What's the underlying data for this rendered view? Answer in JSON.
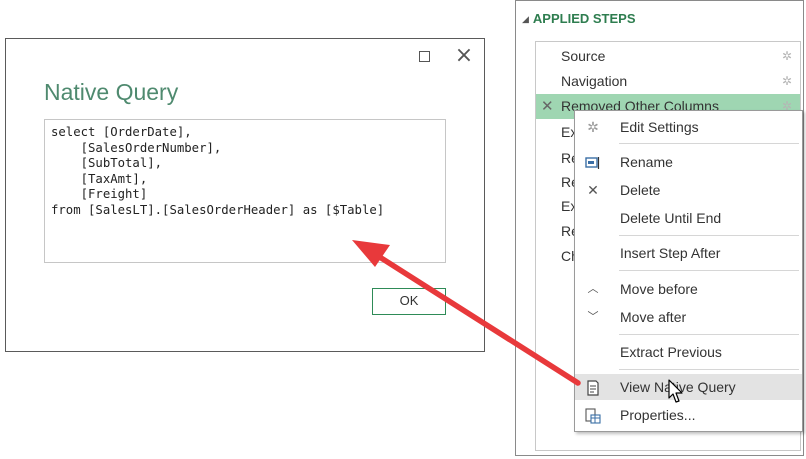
{
  "dialog": {
    "title": "Native Query",
    "query_lines": [
      "select [OrderDate],",
      "    [SalesOrderNumber],",
      "    [SubTotal],",
      "    [TaxAmt],",
      "    [Freight]",
      "from [SalesLT].[SalesOrderHeader] as [$Table]"
    ],
    "maximize_icon": "maximize-icon",
    "close_icon": "close-icon",
    "ok_label": "OK"
  },
  "applied_steps": {
    "header": "APPLIED STEPS",
    "steps": [
      {
        "label": "Source"
      },
      {
        "label": "Navigation"
      },
      {
        "label": "Removed Other Columns"
      }
    ],
    "hidden_fragments": [
      "Ex",
      "Re",
      "Re",
      "Ex",
      "Re",
      "Ch"
    ]
  },
  "context_menu": {
    "items": [
      {
        "label": "Edit Settings",
        "icon": "gear-icon"
      },
      {
        "label": "Rename",
        "icon": "rename-icon"
      },
      {
        "label": "Delete",
        "icon": "delete-icon"
      },
      {
        "label": "Delete Until End",
        "icon": ""
      },
      {
        "label": "Insert Step After",
        "icon": ""
      },
      {
        "label": "Move before",
        "icon": "chevron-up-icon"
      },
      {
        "label": "Move after",
        "icon": "chevron-down-icon"
      },
      {
        "label": "Extract Previous",
        "icon": ""
      },
      {
        "label": "View Native Query",
        "icon": "view-query-icon"
      },
      {
        "label": "Properties...",
        "icon": "properties-icon"
      }
    ]
  },
  "colors": {
    "accent_green": "#2e7d4f",
    "selected_step": "#9fd6b2",
    "arrow_red": "#e8393b"
  }
}
